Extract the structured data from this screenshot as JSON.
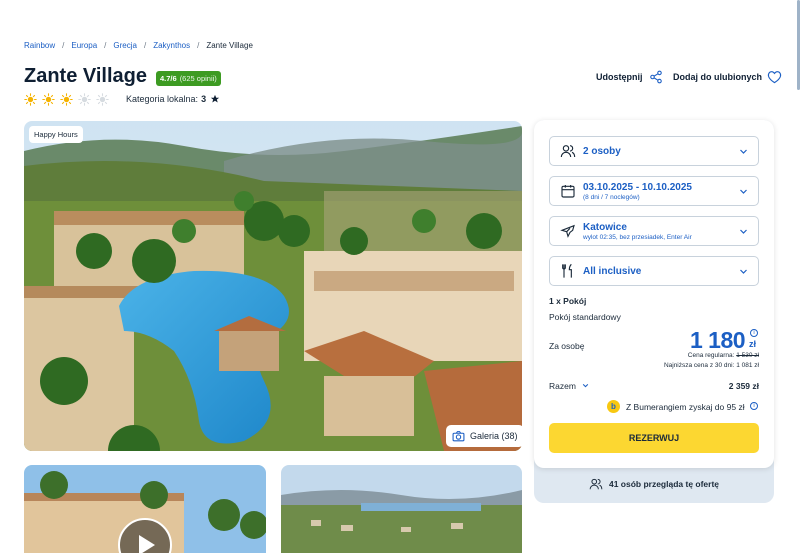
{
  "breadcrumb": {
    "items": [
      "Rainbow",
      "Europa",
      "Grecja",
      "Zakynthos",
      "Zante Village"
    ]
  },
  "hotel": {
    "name": "Zante Village",
    "rating_value": "4.7/6",
    "rating_count": "(625 opinii)",
    "suns_filled": 3,
    "suns_total": 5,
    "category_label": "Kategoria lokalna:",
    "category_value": "3"
  },
  "actions": {
    "share_label": "Udostępnij",
    "favorite_label": "Dodaj do ulubionych"
  },
  "gallery": {
    "badge": "Happy Hours",
    "gallery_label": "Galeria (38)"
  },
  "booking": {
    "persons": "2 osoby",
    "dates": "03.10.2025 - 10.10.2025",
    "dates_sub": "(8 dni / 7 noclegów)",
    "departure": "Katowice",
    "departure_sub": "wylot 02:35, bez przesiadek, Enter Air",
    "board": "All inclusive",
    "room_count": "1 x Pokój",
    "room_type": "Pokój standardowy",
    "per_person_label": "Za osobę",
    "price": "1 180",
    "currency": "zł",
    "regular_label": "Cena regularna:",
    "regular_price": "1 530 zł",
    "lowest_label": "Najniższa cena z 30 dni:",
    "lowest_price": "1 081 zł",
    "total_label": "Razem",
    "total_price": "2 359 zł",
    "bumerang_text": "Z Bumerangiem zyskaj do 95 zł",
    "reserve_label": "REZERWUJ",
    "viewers_text": "41 osób przegląda tę ofertę"
  },
  "colors": {
    "accent": "#1c5fc4",
    "rating_green": "#3d9b22",
    "sun": "#f5b301",
    "button": "#fcd731"
  }
}
